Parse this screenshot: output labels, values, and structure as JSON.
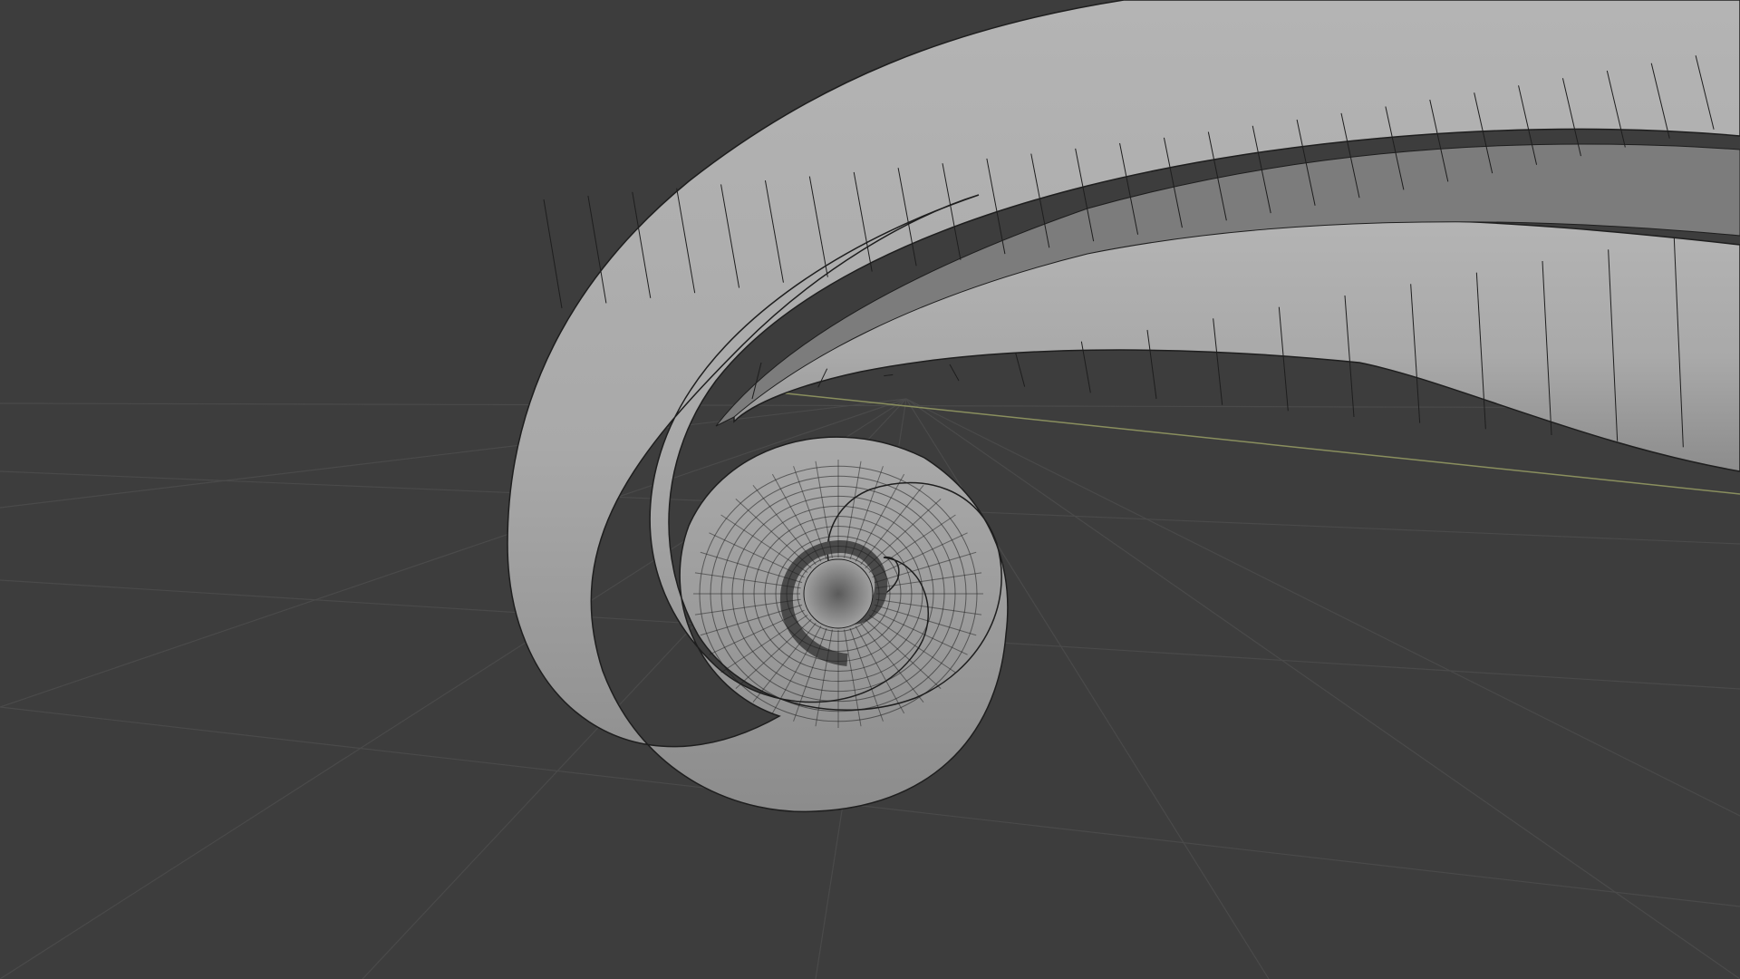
{
  "viewport": {
    "background_color": "#3d3d3d",
    "grid_color": "#4a4a4a",
    "x_axis_color": "#8a8f5e",
    "mesh_surface_color": "#a8a8a8",
    "mesh_shadow_color": "#6e6e6e",
    "wireframe_color": "#1e1e1e"
  },
  "scene": {
    "object": "spiral-horn-mesh",
    "shading": "solid",
    "overlay": "wireframe"
  }
}
